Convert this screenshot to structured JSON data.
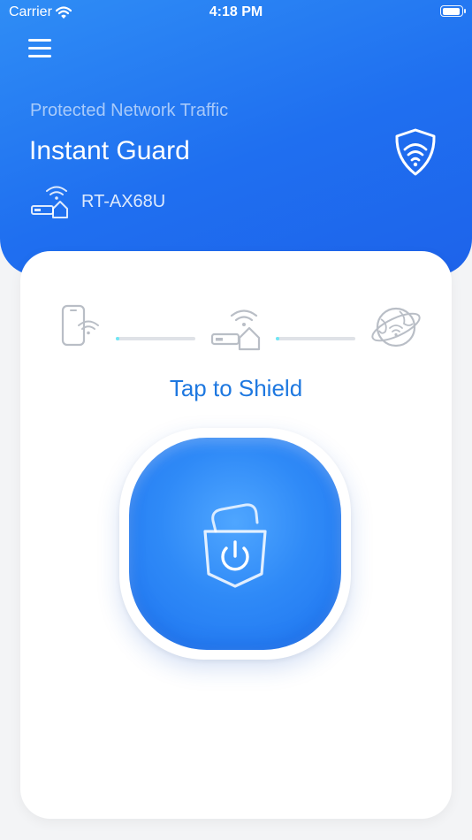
{
  "status_bar": {
    "carrier": "Carrier",
    "time": "4:18 PM"
  },
  "header": {
    "subtitle": "Protected Network Traffic",
    "title": "Instant Guard",
    "router_name": "RT-AX68U",
    "shield_icon": "wifi-shield-icon",
    "router_icon": "router-home-icon",
    "menu_icon": "hamburger-menu-icon"
  },
  "main": {
    "flow_icons": [
      "phone-wifi-icon",
      "router-home-icon",
      "globe-wifi-icon"
    ],
    "tap_label": "Tap to Shield",
    "button_icon": "lock-power-icon"
  },
  "colors": {
    "header_blue": "#1f6ff0",
    "accent_text": "#1e78e0",
    "line_active": "#6fe6f5"
  }
}
